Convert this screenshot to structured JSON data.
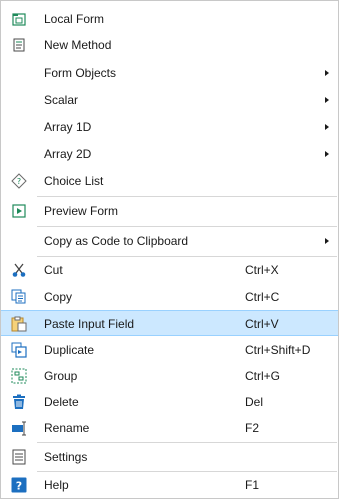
{
  "menu": {
    "items": [
      {
        "label": "Local Form",
        "icon": "local-form-icon"
      },
      {
        "label": "New Method",
        "icon": "new-method-icon"
      },
      {
        "label": "Form Objects",
        "submenu": true
      },
      {
        "label": "Scalar",
        "submenu": true
      },
      {
        "label": "Array 1D",
        "submenu": true
      },
      {
        "label": "Array 2D",
        "submenu": true
      },
      {
        "label": "Choice List",
        "icon": "choice-list-icon"
      },
      {
        "label": "Preview Form",
        "icon": "preview-form-icon"
      },
      {
        "label": "Copy as Code to Clipboard",
        "submenu": true
      },
      {
        "label": "Cut",
        "shortcut": "Ctrl+X",
        "icon": "cut-icon"
      },
      {
        "label": "Copy",
        "shortcut": "Ctrl+C",
        "icon": "copy-icon"
      },
      {
        "label": "Paste Input Field",
        "shortcut": "Ctrl+V",
        "icon": "paste-icon",
        "highlighted": true
      },
      {
        "label": "Duplicate",
        "shortcut": "Ctrl+Shift+D",
        "icon": "duplicate-icon"
      },
      {
        "label": "Group",
        "shortcut": "Ctrl+G",
        "icon": "group-icon"
      },
      {
        "label": "Delete",
        "shortcut": "Del",
        "icon": "delete-icon"
      },
      {
        "label": "Rename",
        "shortcut": "F2",
        "icon": "rename-icon"
      },
      {
        "label": "Settings",
        "icon": "settings-icon"
      },
      {
        "label": "Help",
        "shortcut": "F1",
        "icon": "help-icon"
      }
    ]
  },
  "colors": {
    "highlight": "#cce8ff",
    "highlight_border": "#99d1ff",
    "icon_green": "#1e8a5a",
    "icon_blue": "#1c6fc0",
    "separator": "#d7d7d7"
  }
}
